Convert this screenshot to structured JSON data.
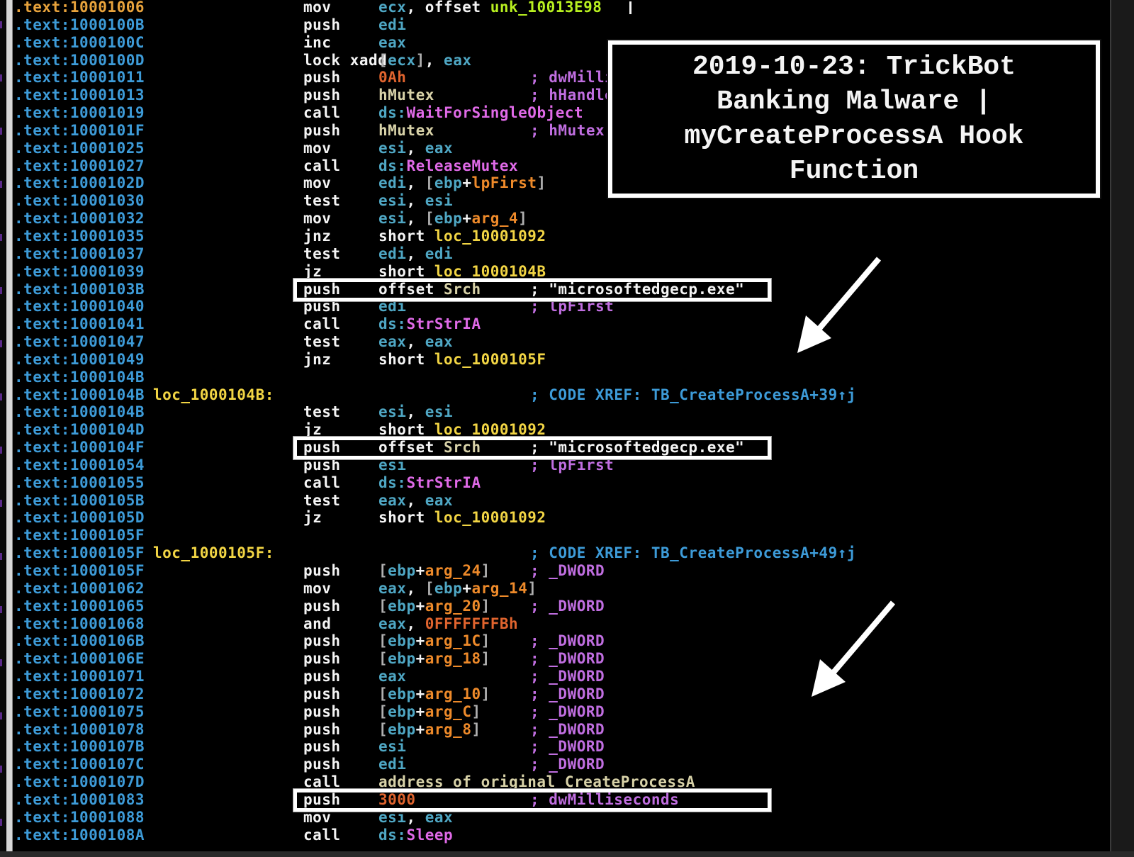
{
  "title_box": {
    "lines": [
      "2019-10-23: TrickBot",
      "Banking Malware |",
      "myCreateProcessA Hook",
      "Function"
    ]
  },
  "colors": {
    "address": "#3d9bd8",
    "current_address": "#e8a33c",
    "label": "#f2d544",
    "mnemonic": "#f4f4f4",
    "register": "#4fa7c4",
    "argument": "#ee8a2a",
    "number": "#e0642e",
    "api": "#e06ae8",
    "comment": "#c06ee0",
    "xref_comment": "#3d9bd8",
    "highlight_box": "#ffffff"
  },
  "lines": [
    {
      "addr": ".text:10001006",
      "current": true,
      "mnem": "mov",
      "ops": [
        [
          "reg",
          "ecx"
        ],
        [
          "plain",
          ", offset "
        ],
        [
          "unk",
          "unk_10013E98"
        ]
      ],
      "cmt": []
    },
    {
      "addr": ".text:1000100B",
      "mnem": "push",
      "ops": [
        [
          "reg",
          "edi"
        ]
      ],
      "cmt": []
    },
    {
      "addr": ".text:1000100C",
      "mnem": "inc",
      "ops": [
        [
          "reg",
          "eax"
        ]
      ],
      "cmt": []
    },
    {
      "addr": ".text:1000100D",
      "mnem": "lock xadd",
      "inline": true,
      "ops": [
        [
          "brk",
          "["
        ],
        [
          "reg",
          "ecx"
        ],
        [
          "brk",
          "]"
        ],
        [
          "plain",
          ", "
        ],
        [
          "reg",
          "eax"
        ]
      ],
      "cmt": []
    },
    {
      "addr": ".text:10001011",
      "mnem": "push",
      "ops": [
        [
          "num",
          "0Ah"
        ]
      ],
      "cmt": [
        [
          "cmt-purple",
          "; dwMilliseconds"
        ]
      ]
    },
    {
      "addr": ".text:10001013",
      "mnem": "push",
      "ops": [
        [
          "glob",
          "hMutex"
        ]
      ],
      "cmt": [
        [
          "cmt-purple",
          "; hHandle"
        ]
      ]
    },
    {
      "addr": ".text:10001019",
      "mnem": "call",
      "ops": [
        [
          "reg",
          "ds:"
        ],
        [
          "api",
          "WaitForSingleObject"
        ]
      ],
      "cmt": []
    },
    {
      "addr": ".text:1000101F",
      "mnem": "push",
      "ops": [
        [
          "glob",
          "hMutex"
        ]
      ],
      "cmt": [
        [
          "cmt-purple",
          "; hMutex"
        ]
      ]
    },
    {
      "addr": ".text:10001025",
      "mnem": "mov",
      "ops": [
        [
          "reg",
          "esi"
        ],
        [
          "plain",
          ", "
        ],
        [
          "reg",
          "eax"
        ]
      ],
      "cmt": []
    },
    {
      "addr": ".text:10001027",
      "mnem": "call",
      "ops": [
        [
          "reg",
          "ds:"
        ],
        [
          "api",
          "ReleaseMutex"
        ]
      ],
      "cmt": []
    },
    {
      "addr": ".text:1000102D",
      "mnem": "mov",
      "ops": [
        [
          "reg",
          "edi"
        ],
        [
          "plain",
          ", "
        ],
        [
          "brk",
          "["
        ],
        [
          "reg",
          "ebp"
        ],
        [
          "plain",
          "+"
        ],
        [
          "arg",
          "lpFirst"
        ],
        [
          "brk",
          "]"
        ]
      ],
      "cmt": []
    },
    {
      "addr": ".text:10001030",
      "mnem": "test",
      "ops": [
        [
          "reg",
          "esi"
        ],
        [
          "plain",
          ", "
        ],
        [
          "reg",
          "esi"
        ]
      ],
      "cmt": []
    },
    {
      "addr": ".text:10001032",
      "mnem": "mov",
      "ops": [
        [
          "reg",
          "esi"
        ],
        [
          "plain",
          ", "
        ],
        [
          "brk",
          "["
        ],
        [
          "reg",
          "ebp"
        ],
        [
          "plain",
          "+"
        ],
        [
          "arg",
          "arg_4"
        ],
        [
          "brk",
          "]"
        ]
      ],
      "cmt": []
    },
    {
      "addr": ".text:10001035",
      "mnem": "jnz",
      "ops": [
        [
          "plain",
          "short "
        ],
        [
          "loc",
          "loc_10001092"
        ]
      ],
      "cmt": []
    },
    {
      "addr": ".text:10001037",
      "mnem": "test",
      "ops": [
        [
          "reg",
          "edi"
        ],
        [
          "plain",
          ", "
        ],
        [
          "reg",
          "edi"
        ]
      ],
      "cmt": []
    },
    {
      "addr": ".text:10001039",
      "mnem": "jz",
      "ops": [
        [
          "plain",
          "short "
        ],
        [
          "loc",
          "loc_1000104B"
        ]
      ],
      "cmt": []
    },
    {
      "addr": ".text:1000103B",
      "mnem": "push",
      "ops": [
        [
          "plain",
          "offset "
        ],
        [
          "glob",
          "Srch"
        ]
      ],
      "cmt": [
        [
          "cmt-white",
          "; \"microsoftedgecp.exe\""
        ]
      ]
    },
    {
      "addr": ".text:10001040",
      "mnem": "push",
      "ops": [
        [
          "reg",
          "edi"
        ]
      ],
      "cmt": [
        [
          "cmt-purple",
          "; lpFirst"
        ]
      ]
    },
    {
      "addr": ".text:10001041",
      "mnem": "call",
      "ops": [
        [
          "reg",
          "ds:"
        ],
        [
          "api",
          "StrStrIA"
        ]
      ],
      "cmt": []
    },
    {
      "addr": ".text:10001047",
      "mnem": "test",
      "ops": [
        [
          "reg",
          "eax"
        ],
        [
          "plain",
          ", "
        ],
        [
          "reg",
          "eax"
        ]
      ],
      "cmt": []
    },
    {
      "addr": ".text:10001049",
      "mnem": "jnz",
      "ops": [
        [
          "plain",
          "short "
        ],
        [
          "loc",
          "loc_1000105F"
        ]
      ],
      "cmt": []
    },
    {
      "addr": ".text:1000104B",
      "mnem": "",
      "ops": [],
      "cmt": []
    },
    {
      "addr": ".text:1000104B",
      "label": "loc_1000104B:",
      "mnem": "",
      "ops": [],
      "cmt": [
        [
          "cmt-blue",
          "; CODE XREF: TB_CreateProcessA+39↑j"
        ]
      ]
    },
    {
      "addr": ".text:1000104B",
      "mnem": "test",
      "ops": [
        [
          "reg",
          "esi"
        ],
        [
          "plain",
          ", "
        ],
        [
          "reg",
          "esi"
        ]
      ],
      "cmt": []
    },
    {
      "addr": ".text:1000104D",
      "mnem": "jz",
      "ops": [
        [
          "plain",
          "short "
        ],
        [
          "loc",
          "loc_10001092"
        ]
      ],
      "cmt": []
    },
    {
      "addr": ".text:1000104F",
      "mnem": "push",
      "ops": [
        [
          "plain",
          "offset "
        ],
        [
          "glob",
          "Srch"
        ]
      ],
      "cmt": [
        [
          "cmt-white",
          "; \"microsoftedgecp.exe\""
        ]
      ]
    },
    {
      "addr": ".text:10001054",
      "mnem": "push",
      "ops": [
        [
          "reg",
          "esi"
        ]
      ],
      "cmt": [
        [
          "cmt-purple",
          "; lpFirst"
        ]
      ]
    },
    {
      "addr": ".text:10001055",
      "mnem": "call",
      "ops": [
        [
          "reg",
          "ds:"
        ],
        [
          "api",
          "StrStrIA"
        ]
      ],
      "cmt": []
    },
    {
      "addr": ".text:1000105B",
      "mnem": "test",
      "ops": [
        [
          "reg",
          "eax"
        ],
        [
          "plain",
          ", "
        ],
        [
          "reg",
          "eax"
        ]
      ],
      "cmt": []
    },
    {
      "addr": ".text:1000105D",
      "mnem": "jz",
      "ops": [
        [
          "plain",
          "short "
        ],
        [
          "loc",
          "loc_10001092"
        ]
      ],
      "cmt": []
    },
    {
      "addr": ".text:1000105F",
      "mnem": "",
      "ops": [],
      "cmt": []
    },
    {
      "addr": ".text:1000105F",
      "label": "loc_1000105F:",
      "mnem": "",
      "ops": [],
      "cmt": [
        [
          "cmt-blue",
          "; CODE XREF: TB_CreateProcessA+49↑j"
        ]
      ]
    },
    {
      "addr": ".text:1000105F",
      "mnem": "push",
      "ops": [
        [
          "brk",
          "["
        ],
        [
          "reg",
          "ebp"
        ],
        [
          "plain",
          "+"
        ],
        [
          "arg",
          "arg_24"
        ],
        [
          "brk",
          "]"
        ]
      ],
      "cmt": [
        [
          "cmt-purple",
          "; _DWORD"
        ]
      ]
    },
    {
      "addr": ".text:10001062",
      "mnem": "mov",
      "ops": [
        [
          "reg",
          "eax"
        ],
        [
          "plain",
          ", "
        ],
        [
          "brk",
          "["
        ],
        [
          "reg",
          "ebp"
        ],
        [
          "plain",
          "+"
        ],
        [
          "arg",
          "arg_14"
        ],
        [
          "brk",
          "]"
        ]
      ],
      "cmt": []
    },
    {
      "addr": ".text:10001065",
      "mnem": "push",
      "ops": [
        [
          "brk",
          "["
        ],
        [
          "reg",
          "ebp"
        ],
        [
          "plain",
          "+"
        ],
        [
          "arg",
          "arg_20"
        ],
        [
          "brk",
          "]"
        ]
      ],
      "cmt": [
        [
          "cmt-purple",
          "; _DWORD"
        ]
      ]
    },
    {
      "addr": ".text:10001068",
      "mnem": "and",
      "ops": [
        [
          "reg",
          "eax"
        ],
        [
          "plain",
          ", "
        ],
        [
          "num",
          "0FFFFFFFBh"
        ]
      ],
      "cmt": []
    },
    {
      "addr": ".text:1000106B",
      "mnem": "push",
      "ops": [
        [
          "brk",
          "["
        ],
        [
          "reg",
          "ebp"
        ],
        [
          "plain",
          "+"
        ],
        [
          "arg",
          "arg_1C"
        ],
        [
          "brk",
          "]"
        ]
      ],
      "cmt": [
        [
          "cmt-purple",
          "; _DWORD"
        ]
      ]
    },
    {
      "addr": ".text:1000106E",
      "mnem": "push",
      "ops": [
        [
          "brk",
          "["
        ],
        [
          "reg",
          "ebp"
        ],
        [
          "plain",
          "+"
        ],
        [
          "arg",
          "arg_18"
        ],
        [
          "brk",
          "]"
        ]
      ],
      "cmt": [
        [
          "cmt-purple",
          "; _DWORD"
        ]
      ]
    },
    {
      "addr": ".text:10001071",
      "mnem": "push",
      "ops": [
        [
          "reg",
          "eax"
        ]
      ],
      "cmt": [
        [
          "cmt-purple",
          "; _DWORD"
        ]
      ]
    },
    {
      "addr": ".text:10001072",
      "mnem": "push",
      "ops": [
        [
          "brk",
          "["
        ],
        [
          "reg",
          "ebp"
        ],
        [
          "plain",
          "+"
        ],
        [
          "arg",
          "arg_10"
        ],
        [
          "brk",
          "]"
        ]
      ],
      "cmt": [
        [
          "cmt-purple",
          "; _DWORD"
        ]
      ]
    },
    {
      "addr": ".text:10001075",
      "mnem": "push",
      "ops": [
        [
          "brk",
          "["
        ],
        [
          "reg",
          "ebp"
        ],
        [
          "plain",
          "+"
        ],
        [
          "arg",
          "arg_C"
        ],
        [
          "brk",
          "]"
        ]
      ],
      "cmt": [
        [
          "cmt-purple",
          "; _DWORD"
        ]
      ]
    },
    {
      "addr": ".text:10001078",
      "mnem": "push",
      "ops": [
        [
          "brk",
          "["
        ],
        [
          "reg",
          "ebp"
        ],
        [
          "plain",
          "+"
        ],
        [
          "arg",
          "arg_8"
        ],
        [
          "brk",
          "]"
        ]
      ],
      "cmt": [
        [
          "cmt-purple",
          "; _DWORD"
        ]
      ]
    },
    {
      "addr": ".text:1000107B",
      "mnem": "push",
      "ops": [
        [
          "reg",
          "esi"
        ]
      ],
      "cmt": [
        [
          "cmt-purple",
          "; _DWORD"
        ]
      ]
    },
    {
      "addr": ".text:1000107C",
      "mnem": "push",
      "ops": [
        [
          "reg",
          "edi"
        ]
      ],
      "cmt": [
        [
          "cmt-purple",
          "; _DWORD"
        ]
      ]
    },
    {
      "addr": ".text:1000107D",
      "mnem": "call",
      "ops": [
        [
          "glob",
          "address_of_original_CreateProcessA"
        ]
      ],
      "cmt": []
    },
    {
      "addr": ".text:10001083",
      "mnem": "push",
      "ops": [
        [
          "num",
          "3000"
        ]
      ],
      "cmt": [
        [
          "cmt-purple",
          "; dwMilliseconds"
        ]
      ]
    },
    {
      "addr": ".text:10001088",
      "mnem": "mov",
      "ops": [
        [
          "reg",
          "esi"
        ],
        [
          "plain",
          ", "
        ],
        [
          "reg",
          "eax"
        ]
      ],
      "cmt": []
    },
    {
      "addr": ".text:1000108A",
      "mnem": "call",
      "ops": [
        [
          "reg",
          "ds:"
        ],
        [
          "api",
          "Sleep"
        ]
      ],
      "cmt": []
    }
  ],
  "highlighted_lines": [
    16,
    25,
    45
  ]
}
